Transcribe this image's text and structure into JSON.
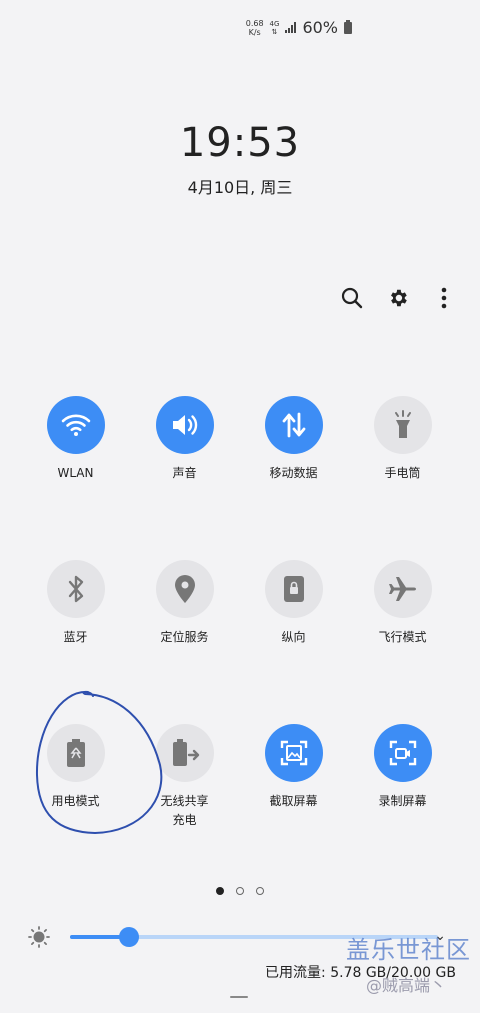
{
  "status": {
    "net_speed_value": "0.68",
    "net_speed_unit": "K/s",
    "network": "4G",
    "battery_percent": "60%"
  },
  "clock": {
    "time": "19:53",
    "date": "4月10日, 周三"
  },
  "top_actions": {
    "icons": [
      "search-icon",
      "gear-icon",
      "more-vertical-icon"
    ]
  },
  "tiles": [
    {
      "label": "WLAN",
      "icon": "wifi-icon",
      "on": true
    },
    {
      "label": "声音",
      "icon": "sound-icon",
      "on": true
    },
    {
      "label": "移动数据",
      "icon": "mobile-data-icon",
      "on": true
    },
    {
      "label": "手电筒",
      "icon": "flashlight-icon",
      "on": false
    },
    {
      "label": "蓝牙",
      "icon": "bluetooth-icon",
      "on": false
    },
    {
      "label": "定位服务",
      "icon": "location-icon",
      "on": false
    },
    {
      "label": "纵向",
      "icon": "portrait-lock-icon",
      "on": false
    },
    {
      "label": "飞行模式",
      "icon": "airplane-icon",
      "on": false
    },
    {
      "label": "用电模式",
      "icon": "battery-mode-icon",
      "on": false
    },
    {
      "label": "无线共享\n充电",
      "label_line1": "无线共享",
      "label_line2": "充电",
      "icon": "wireless-powershare-icon",
      "on": false
    },
    {
      "label": "截取屏幕",
      "icon": "screenshot-icon",
      "on": true
    },
    {
      "label": "录制屏幕",
      "icon": "screen-record-icon",
      "on": true
    }
  ],
  "pager": {
    "pages": 3,
    "current": 1
  },
  "brightness": {
    "level": 0.16
  },
  "data_usage": "已用流量: 5.78 GB/20.00 GB",
  "watermark": {
    "brand": "盖乐世社区",
    "user": "@贼高端丶"
  },
  "colors": {
    "accent": "#3d8df5",
    "tile_off": "#e4e4e7",
    "scribble": "#2e4fae"
  }
}
